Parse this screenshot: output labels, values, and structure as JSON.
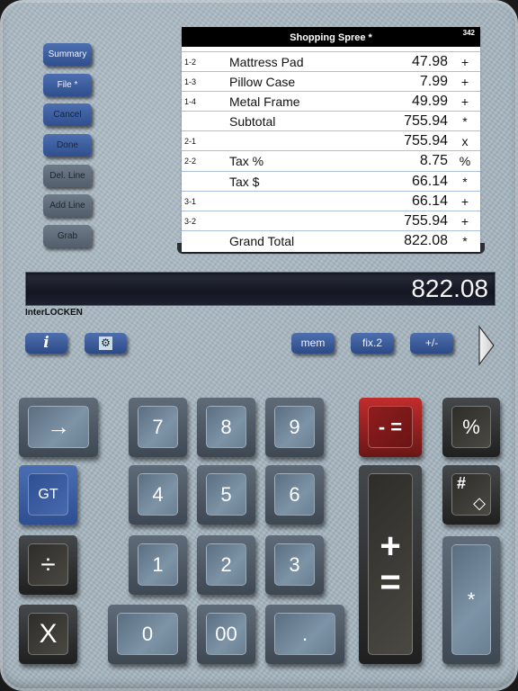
{
  "side_buttons": [
    {
      "label": "Summary",
      "style": "blue"
    },
    {
      "label": "File *",
      "style": "blue"
    },
    {
      "label": "Cancel",
      "style": "blue-dark"
    },
    {
      "label": "Done",
      "style": "blue-dark"
    },
    {
      "label": "Del. Line",
      "style": "gray"
    },
    {
      "label": "Add Line",
      "style": "gray"
    },
    {
      "label": "Grab",
      "style": "gray"
    }
  ],
  "tape": {
    "title": "Shopping Spree *",
    "count": "342",
    "rows": [
      {
        "ref": "1-2",
        "desc": "Mattress Pad",
        "amount": "47.98",
        "op": "+"
      },
      {
        "ref": "1-3",
        "desc": "Pillow Case",
        "amount": "7.99",
        "op": "+"
      },
      {
        "ref": "1-4",
        "desc": "Metal Frame",
        "amount": "49.99",
        "op": "+"
      },
      {
        "ref": "",
        "desc": "Subtotal",
        "amount": "755.94",
        "op": "*"
      },
      {
        "ref": "2-1",
        "desc": "",
        "amount": "755.94",
        "op": "x"
      },
      {
        "ref": "2-2",
        "desc": "Tax %",
        "amount": "8.75",
        "op": "%"
      },
      {
        "ref": "",
        "desc": "Tax $",
        "amount": "66.14",
        "op": "*"
      },
      {
        "ref": "3-1",
        "desc": "",
        "amount": "66.14",
        "op": "+"
      },
      {
        "ref": "3-2",
        "desc": "",
        "amount": "755.94",
        "op": "+"
      },
      {
        "ref": "",
        "desc": "Grand Total",
        "amount": "822.08",
        "op": "*"
      }
    ]
  },
  "display": {
    "value": "822.08"
  },
  "brand": "InterLOCKEN",
  "function_buttons": {
    "info_icon": "info-icon",
    "settings_icon": "gear-icon",
    "mem": "mem",
    "fix": "fix.2",
    "sign": "+/-",
    "next_icon": "triangle-right-icon"
  },
  "keys": {
    "arrow": "→",
    "gt": "GT",
    "divide": "÷",
    "multiply": "X",
    "seven": "7",
    "eight": "8",
    "nine": "9",
    "four": "4",
    "five": "5",
    "six": "6",
    "one": "1",
    "two": "2",
    "three": "3",
    "zero": "0",
    "double_zero": "00",
    "decimal": ".",
    "minus_equals": "- =",
    "percent": "%",
    "hash": "#",
    "diamond": "◇",
    "plus": "+",
    "equals": "=",
    "star": "*"
  },
  "colors": {
    "panel": "#a6b5c0",
    "key_red": "#b02626",
    "key_blue": "#3d5fa3",
    "display_bg": "#161824"
  }
}
